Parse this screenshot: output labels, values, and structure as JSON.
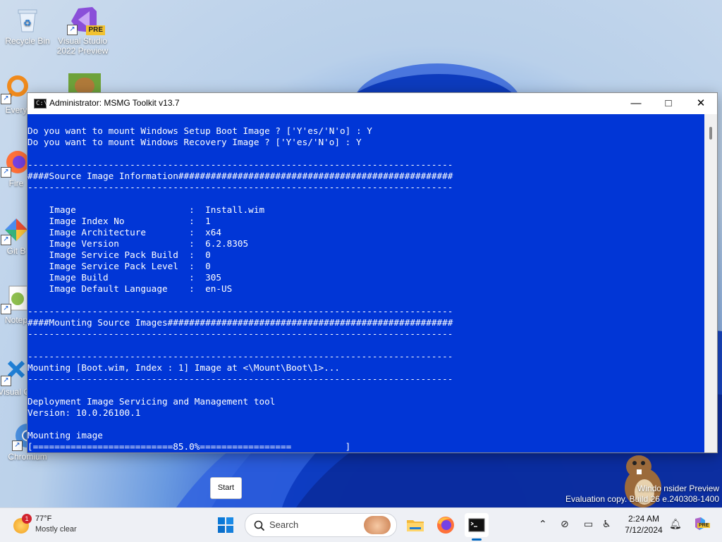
{
  "desktop": {
    "icons": [
      {
        "label": "Recycle Bin"
      },
      {
        "label": "Visual Studio 2022 Preview",
        "badge": "PRE"
      },
      {
        "label": "Every"
      },
      {
        "label": "Fire"
      },
      {
        "label": "Git B"
      },
      {
        "label": "Notep"
      },
      {
        "label": "Visual Co"
      },
      {
        "label": "Chromium"
      }
    ]
  },
  "window": {
    "title": "Administrator:  MSMG Toolkit v13.7",
    "icon_text": "C:\\",
    "controls": {
      "minimize": "—",
      "maximize": "□",
      "close": "✕"
    },
    "console_lines": [
      "Do you want to mount Windows Setup Boot Image ? ['Y'es/'N'o] : Y",
      "Do you want to mount Windows Recovery Image ? ['Y'es/'N'o] : Y",
      "",
      "-------------------------------------------------------------------------------",
      "####Source Image Information###################################################",
      "-------------------------------------------------------------------------------",
      "",
      "    Image                     :  Install.wim",
      "    Image Index No            :  1",
      "    Image Architecture        :  x64",
      "    Image Version             :  6.2.8305",
      "    Image Service Pack Build  :  0",
      "    Image Service Pack Level  :  0",
      "    Image Build               :  305",
      "    Image Default Language    :  en-US",
      "",
      "-------------------------------------------------------------------------------",
      "####Mounting Source Images#####################################################",
      "-------------------------------------------------------------------------------",
      "",
      "-------------------------------------------------------------------------------",
      "Mounting [Boot.wim, Index : 1] Image at <\\Mount\\Boot\\1>...",
      "-------------------------------------------------------------------------------",
      "",
      "Deployment Image Servicing and Management tool",
      "Version: 10.0.26100.1",
      "",
      "Mounting image",
      "[==========================85.0%=================          ]"
    ]
  },
  "tooltip": {
    "text": "Start"
  },
  "watermark": {
    "line1": "Windo             nsider Preview",
    "line2": "Evaluation copy. Build 26            e.240308-1400"
  },
  "taskbar": {
    "weather": {
      "temp": "77°F",
      "condition": "Mostly clear",
      "badge": "1"
    },
    "search_label": "Search",
    "clock": {
      "time": "2:24 AM",
      "date": "7/12/2024"
    },
    "copilot_badge": "PRE"
  },
  "colors": {
    "console_bg": "#0136d6",
    "console_fg": "#ffffff",
    "taskbar_bg": "#eef0f5",
    "accent": "#0067c0"
  }
}
